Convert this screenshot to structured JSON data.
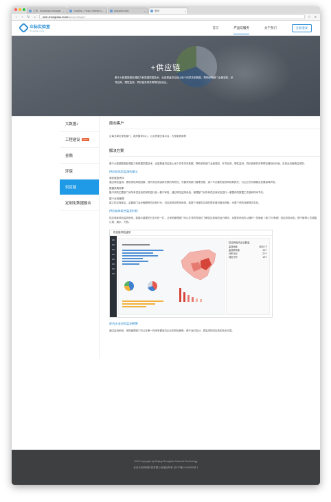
{
  "browser": {
    "tabs": [
      {
        "label": "工作 - Bootstrap Manager"
      },
      {
        "label": "Graphiq - Heap | Mobile u..."
      },
      {
        "label": "jmjtoptd.mobi"
      },
      {
        "label": "首页"
      }
    ],
    "url_host": "web.zhongbiao.mobi",
    "url_path": "/account/login/",
    "colors": {
      "dot_red": "#ff5f57",
      "dot_yellow": "#ffbd2e",
      "dot_green": "#28c940"
    }
  },
  "header": {
    "logo_text": "众标实验室",
    "logo_sub": "zhongbiao.mobi",
    "nav": [
      {
        "label": "首页"
      },
      {
        "label": "产品与服务"
      },
      {
        "label": "关于我们"
      }
    ],
    "login_label": "注册/登录",
    "accent": "#2b8ed6"
  },
  "banner": {
    "title": "+供应链",
    "text": "基于大数据数据处理能力和数据挖掘技术、全量覆盖供应链上每个供求关系数据，帮助采购部门全景感知、秒寻自商、理性监测、洞识链条财务等帮控系统出。"
  },
  "sidebar": {
    "items": [
      {
        "label": "大数据+"
      },
      {
        "label": "工程建设",
        "badge": "NEW"
      },
      {
        "label": "金融"
      },
      {
        "label": "环保"
      },
      {
        "label": "供应链"
      },
      {
        "label": "定制化数据融合"
      }
    ],
    "active_color": "#1e9ae6"
  },
  "main": {
    "section1_title": "面向客户",
    "section1_text": "企事业单位采购部门、政府集采中心、公共资源交易平台、大型制造商等",
    "section2_title": "解决方案",
    "section2_text": "基于大数据数据处理能力和数据挖掘技术，全量覆盖供应链上每个供求关系数据，帮助采购部门全景感知、秒寻自商、理性监测、洞识链条财务等帮控管制化升值、实现全流程精益采购。",
    "sub1_title": "供应商风险监测的意义",
    "items": [
      {
        "head": "强化就投资评",
        "text": "通过风险监测，提前发现风险因素，提升供应商选择决策的有效性，完善采购部门管理流程，减少不必要的投资风险和损失，为企业的长期稳定发展保驾护航。"
      },
      {
        "head": "提高采购效率",
        "text": "集中采购主要部门对所有供应商的采购进行统一集中审查，通过风险监测系统，管理部门对所有供应商状态进行一套整体的数据工作量和时间节约。"
      },
      {
        "head": "整个业务管理",
        "text": "建立供应商库后，监管部门及全程跟踪供应商行为，供应商风险预测系统，能整个流程供应商的整体情况做出判断，为整个采购流程提供支持。"
      }
    ],
    "sub2_title": "供应商库综合监测分析",
    "sub2_text": "供应商库风险监测系统，能展示重要的日志分析一栏，让采购管理部门可以在非同时相位了解供应商库的运行情况，对整体系统可以随时一览局面（商门与/季度）供应风险动态，便于管理人员调整、汇报、展示、归档。",
    "shot": {
      "title": "供应链风险监测",
      "side_title": "供应商库内企业数量",
      "stats": [
        {
          "k": "监测对象",
          "v": "45201个"
        },
        {
          "k": "监测事件数",
          "v": "18个"
        },
        {
          "k": "分布行业",
          "v": "22个"
        },
        {
          "k": "地区分布",
          "v": "18个"
        }
      ]
    },
    "sub3_title": "库内企业风险监测预警",
    "sub3_text": "通过监测系统，采购管理部门可以在第一时间掌握库内企业的风险舆情，便于及时应对，提高采购供应商的安全可靠。"
  },
  "footer": {
    "line1": "2015 Copyright by Beijing Zhongbiao Network Technology",
    "line2": "北京众标网络科技有限公司版权所有 京ICP备14048889号-1"
  }
}
